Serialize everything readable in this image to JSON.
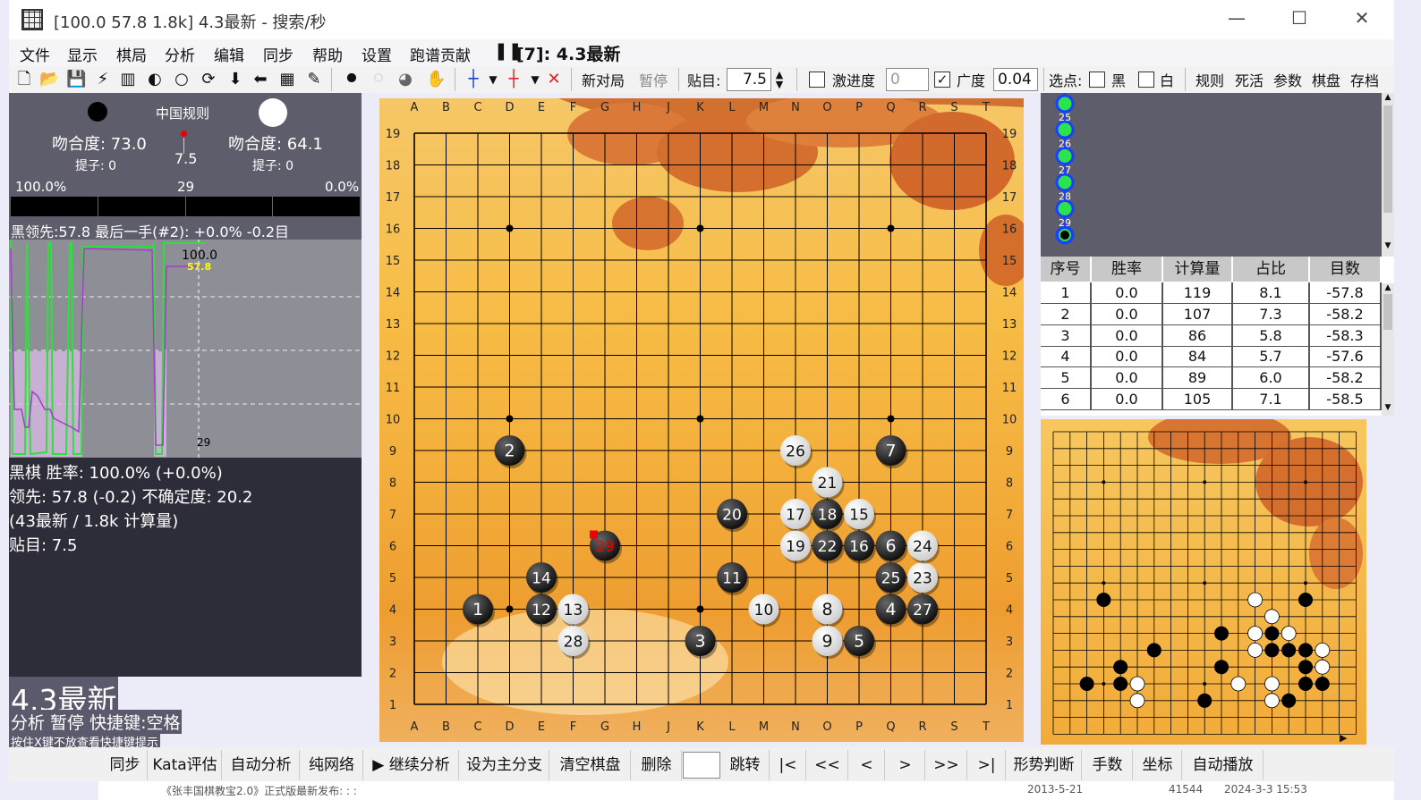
{
  "window": {
    "title": "[100.0 57.8 1.8k] 4.3最新 - 搜索/秒",
    "minimize": "—",
    "maximize": "☐",
    "close": "✕"
  },
  "menu": [
    "文件",
    "显示",
    "棋局",
    "分析",
    "编辑",
    "同步",
    "帮助",
    "设置",
    "跑谱贡献"
  ],
  "menu_status": "[7]: 4.3最新",
  "toolbar": {
    "new_game": "新对局",
    "pause": "暂停",
    "komi_label": "贴目:",
    "komi": "7.5",
    "aggressive_label": "激进度",
    "aggressive": "0",
    "breadth_label": "广度",
    "breadth": "0.04",
    "select_label": "选点:",
    "black": "黑",
    "white": "白",
    "rules": "规则",
    "life_death": "死活",
    "params": "参数",
    "board": "棋盘",
    "save": "存档"
  },
  "left": {
    "rule": "中国规则",
    "black_match": "吻合度: 73.0",
    "white_match": "吻合度: 64.1",
    "black_captures": "提子: 0",
    "white_captures": "提子: 0",
    "komi": "7.5",
    "win_left": "100.0%",
    "move_no": "29",
    "win_right": "0.0%",
    "lead_line": "黑领先:57.8 最后一手(#2): +0.0% -0.2目",
    "graph_top": "100.0",
    "graph_sub": "57.8",
    "graph_x": "29",
    "info": [
      "黑棋 胜率: 100.0% (+0.0%)",
      "领先: 57.8 (-0.2) 不确定度: 20.2",
      "(43最新 / 1.8k 计算量)",
      "贴目: 7.5"
    ],
    "big_name": "4.3最新",
    "status": "分析 暂停 快捷键:空格",
    "hint": "按住X键不放查看快捷键提示"
  },
  "board": {
    "cols": [
      "A",
      "B",
      "C",
      "D",
      "E",
      "F",
      "G",
      "H",
      "J",
      "K",
      "L",
      "M",
      "N",
      "O",
      "P",
      "Q",
      "R",
      "S",
      "T"
    ],
    "rows": [
      "19",
      "18",
      "17",
      "16",
      "15",
      "14",
      "13",
      "12",
      "11",
      "10",
      "9",
      "8",
      "7",
      "6",
      "5",
      "4",
      "3",
      "2",
      "1"
    ],
    "stones": [
      {
        "n": "1",
        "c": "b",
        "col": "C",
        "row": "4"
      },
      {
        "n": "2",
        "c": "b",
        "col": "D",
        "row": "9"
      },
      {
        "n": "3",
        "c": "b",
        "col": "K",
        "row": "3"
      },
      {
        "n": "4",
        "c": "b",
        "col": "Q",
        "row": "4"
      },
      {
        "n": "5",
        "c": "b",
        "col": "P",
        "row": "3"
      },
      {
        "n": "6",
        "c": "b",
        "col": "Q",
        "row": "6"
      },
      {
        "n": "7",
        "c": "b",
        "col": "Q",
        "row": "9"
      },
      {
        "n": "8",
        "c": "w",
        "col": "O",
        "row": "4"
      },
      {
        "n": "9",
        "c": "w",
        "col": "O",
        "row": "3"
      },
      {
        "n": "10",
        "c": "w",
        "col": "M",
        "row": "4"
      },
      {
        "n": "11",
        "c": "b",
        "col": "L",
        "row": "5"
      },
      {
        "n": "12",
        "c": "b",
        "col": "E",
        "row": "4"
      },
      {
        "n": "13",
        "c": "w",
        "col": "F",
        "row": "4"
      },
      {
        "n": "14",
        "c": "b",
        "col": "E",
        "row": "5"
      },
      {
        "n": "15",
        "c": "w",
        "col": "P",
        "row": "7"
      },
      {
        "n": "16",
        "c": "b",
        "col": "P",
        "row": "6"
      },
      {
        "n": "17",
        "c": "w",
        "col": "N",
        "row": "7"
      },
      {
        "n": "18",
        "c": "b",
        "col": "O",
        "row": "7"
      },
      {
        "n": "19",
        "c": "w",
        "col": "N",
        "row": "6"
      },
      {
        "n": "20",
        "c": "b",
        "col": "L",
        "row": "7"
      },
      {
        "n": "21",
        "c": "w",
        "col": "O",
        "row": "8"
      },
      {
        "n": "22",
        "c": "b",
        "col": "O",
        "row": "6"
      },
      {
        "n": "23",
        "c": "w",
        "col": "R",
        "row": "5"
      },
      {
        "n": "24",
        "c": "w",
        "col": "R",
        "row": "6"
      },
      {
        "n": "25",
        "c": "b",
        "col": "Q",
        "row": "5"
      },
      {
        "n": "26",
        "c": "w",
        "col": "N",
        "row": "9"
      },
      {
        "n": "27",
        "c": "b",
        "col": "R",
        "row": "4"
      },
      {
        "n": "28",
        "c": "w",
        "col": "F",
        "row": "3"
      },
      {
        "n": "29",
        "c": "b",
        "col": "G",
        "row": "6",
        "last": true
      }
    ]
  },
  "tree": [
    "25",
    "26",
    "27",
    "28",
    "29"
  ],
  "table": {
    "headers": [
      "序号",
      "胜率",
      "计算量",
      "占比",
      "目数"
    ],
    "rows": [
      [
        "1",
        "0.0",
        "119",
        "8.1",
        "-57.8"
      ],
      [
        "2",
        "0.0",
        "107",
        "7.3",
        "-58.2"
      ],
      [
        "3",
        "0.0",
        "86",
        "5.8",
        "-58.3"
      ],
      [
        "4",
        "0.0",
        "84",
        "5.7",
        "-57.6"
      ],
      [
        "5",
        "0.0",
        "89",
        "6.0",
        "-58.2"
      ],
      [
        "6",
        "0.0",
        "105",
        "7.1",
        "-58.5"
      ]
    ]
  },
  "bottom": [
    "同步",
    "Kata评估",
    "自动分析",
    "纯网络",
    "▶ 继续分析",
    "设为主分支",
    "清空棋盘",
    "删除",
    "",
    "跳转",
    "|<",
    "<<",
    "<",
    ">",
    ">>",
    ">|",
    "形势判断",
    "手数",
    "坐标",
    "自动播放"
  ],
  "taskbar_peek": {
    "a": "《张丰国棋教宝2.0》正式版最新发布: : :",
    "b": "2013-5-21",
    "c": "41544",
    "d": "2024-3-3 15:53"
  }
}
